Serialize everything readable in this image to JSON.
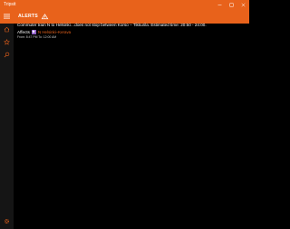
{
  "app": {
    "title": "Tripsit"
  },
  "header": {
    "title": "ALERTS"
  },
  "alert": {
    "message": "Commuter train N to Helsinki…does not stop between Korso – Tikkurila. Estimated time: 20:50 - 24:00.",
    "affects_label": "Affects",
    "route": "N  Helsinki–Kerava",
    "validity": "From: 8:47 PM  To: 12:00 AM"
  },
  "colors": {
    "accent": "#e8621b",
    "route_badge": "#8d5bc7",
    "sidebar": "#151515"
  },
  "icons": {
    "window": [
      "minimize-icon",
      "maximize-icon",
      "close-icon"
    ],
    "nav": [
      "hamburger-menu-icon",
      "home-icon",
      "star-icon",
      "search-icon",
      "settings-icon"
    ],
    "header": "alerts-icon",
    "route": "train-icon"
  }
}
